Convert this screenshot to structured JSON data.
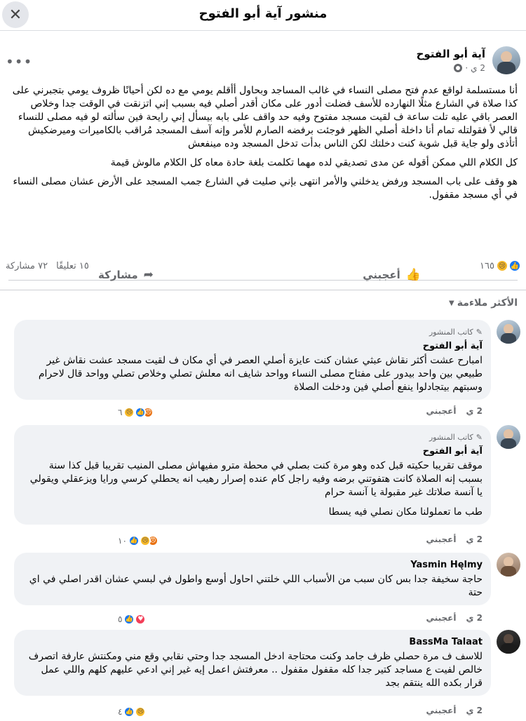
{
  "header": {
    "title": "منشور آية أبو الفتوح",
    "close_icon": "✕"
  },
  "post": {
    "author": "آية أبو الفتوح",
    "time": "2 ي",
    "paragraphs": [
      "أنا مستسلمة لواقع عدم فتح مصلى النساء في غالب المساجد وبحاول أأقلم يومي مع ده لكن أحيانًا ظروف يومي بتجبرني على كذا صلاة في الشارع مثلًا النهارده للأسف فضلت أدور على مكان أقدر أصلي فيه بسبب إني اتزنقت في الوقت جدا وخلاص العصر باقي عليه تلت ساعة ف لقيت مسجد مفتوح وفيه حد واقف على بابه بيسأل إني رايحة فين سألته لو فيه مصلى للنساء قالي لأ فقولتله تمام أنا داخلة أصلي الظهر فوجئت برفضه الصارم للأمر وإنه آسف المسجد مُراقب بالكاميرات وميرضكيش أتأذى ولو جاية قبل شوية كنت دخلتك لكن الناس بدأت تدخل المسجد وده مينفعش",
      "كل الكلام اللي ممكن أقوله عن مدى تصديقي لده مهما تكلمت بلغة حادة معاه كل الكلام مالوش قيمة",
      "هو وقف على باب المسجد ورفض يدخلني والأمر انتهى بإني صليت في الشارع جمب المسجد على الأرض عشان مصلى النساء في أي مسجد مقفول."
    ],
    "reaction_count": "١٦٥",
    "comments_count": "١٥ تعليقًا",
    "shares_count": "٧٢ مشاركة",
    "like_label": "أعجبني",
    "share_label": "مشاركة"
  },
  "sort_label": "الأكثر ملاءمة",
  "comments": [
    {
      "badge": "كاتب المنشور",
      "name": "آية أبو الفتوح",
      "text": "امبارح عشت أكثر نقاش عبثي عشان كنت عايزة أصلي العصر في أي مكان ف لقيت مسجد عشت نقاش غير طبيعي بين واحد بيدور على مفتاح مصلى النساء وواحد شايف انه معلش تصلي وخلاص تصلي وواحد قال لاحرام وسبتهم بيتجادلوا ينفع أصلي فين ودخلت الصلاة",
      "time": "2 ي",
      "like": "أعجبني",
      "count": "٦"
    },
    {
      "badge": "كاتب المنشور",
      "name": "آية أبو الفتوح",
      "text": "موقف تقريبا حكيته قبل كده وهو مرة كنت بصلي في محطة مترو مفيهاش مصلى المنيب تقريبا قبل كذا سنة بسبب إنه الصلاة كانت هتفوتني برضه وفيه راجل كام عنده إصرار رهيب انه يحطلي كرسي ورايا ويزعقلي ويقولي يا آنسة صلاتك غير مقبولة يا آنسة حرام",
      "text2": "طب ما تعملولنا مكان نصلي فيه يسطا",
      "time": "2 ي",
      "like": "أعجبني",
      "count": "١٠"
    },
    {
      "badge": "",
      "name": "Yasmin Hęlmy",
      "text": "حاجة سخيفة جدا بس كان سبب من الأسباب اللي خلتني احاول أوسع واطول في لبسي عشان اقدر اصلي في اي حتة",
      "time": "2 ي",
      "like": "أعجبني",
      "count": "٥"
    },
    {
      "badge": "",
      "name": "BassMa Talaat",
      "text": "للاسف ف مرة حصلي ظرف جامد وكنت محتاجة ادخل المسجد جدا وحتي نقابي وقع مني ومكنتش عارفة اتصرف خالص لفيت ع مساجد كتير جدا كله مقفول مقفول .. معرفتش اعمل إيه غير إني ادعي عليهم كلهم واللي عمل قرار بكده الله ينتقم بجد",
      "time": "2 ي",
      "like": "أعجبني",
      "count": "٤"
    }
  ]
}
